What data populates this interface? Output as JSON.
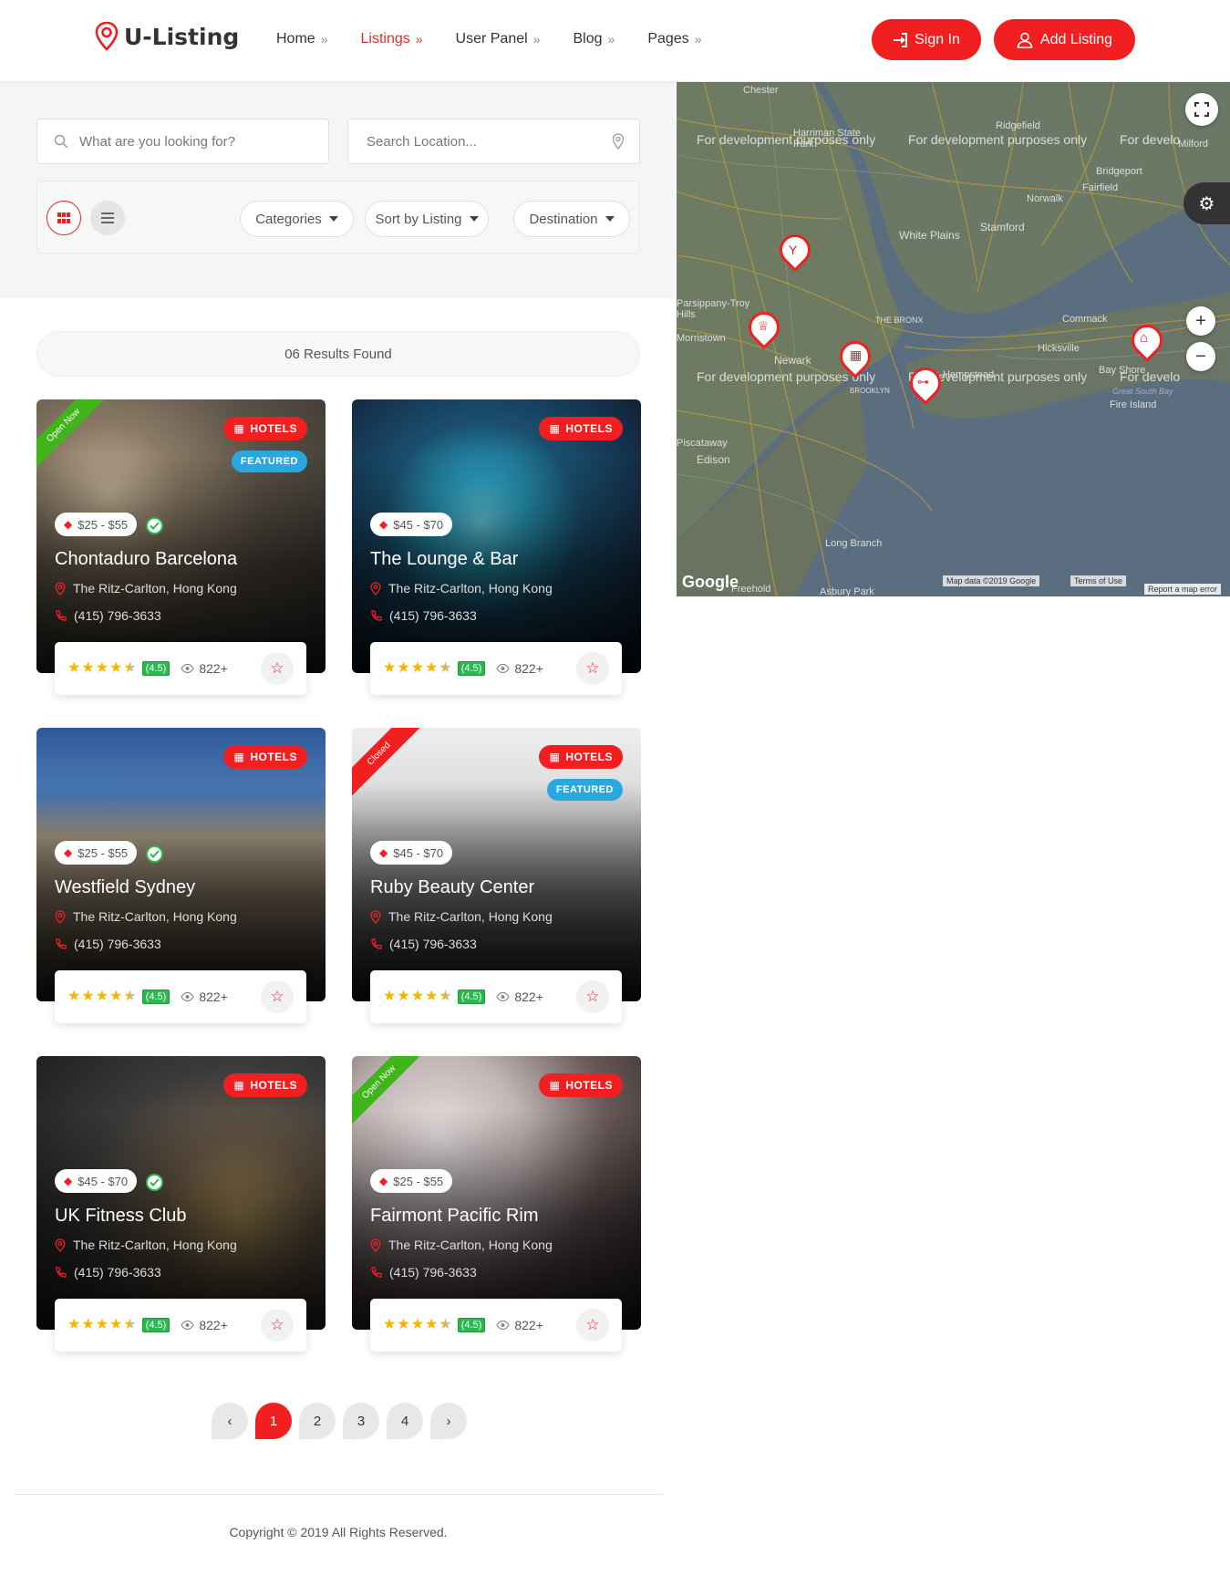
{
  "header": {
    "logo_text": "U-Listing",
    "nav": [
      {
        "label": "Home",
        "active": false
      },
      {
        "label": "Listings",
        "active": true
      },
      {
        "label": "User Panel",
        "active": false
      },
      {
        "label": "Blog",
        "active": false
      },
      {
        "label": "Pages",
        "active": false
      }
    ],
    "sign_in_label": "Sign In",
    "add_listing_label": "Add Listing"
  },
  "search": {
    "query_placeholder": "What are you looking for?",
    "location_placeholder": "Search Location..."
  },
  "filters": {
    "categories_label": "Categories",
    "sort_label": "Sort by Listing",
    "destination_label": "Destination"
  },
  "results_text": "06 Results Found",
  "colors": {
    "accent": "#f21f21",
    "featured": "#29a8e0",
    "open": "#3fb51b",
    "rating": "#2db84d",
    "star": "#f4b400"
  },
  "listings": [
    {
      "title": "Chontaduro Barcelona",
      "category": "HOTELS",
      "featured": "FEATURED",
      "ribbon": "Open Now",
      "price": "$25 - $55",
      "verified": true,
      "address": "The Ritz-Carlton, Hong Kong",
      "phone": "(415) 796-3633",
      "rating": "(4.5)",
      "views": "822+"
    },
    {
      "title": "The Lounge & Bar",
      "category": "HOTELS",
      "featured": "",
      "ribbon": "",
      "price": "$45 - $70",
      "verified": false,
      "address": "The Ritz-Carlton, Hong Kong",
      "phone": "(415) 796-3633",
      "rating": "(4.5)",
      "views": "822+"
    },
    {
      "title": "Westfield Sydney",
      "category": "HOTELS",
      "featured": "",
      "ribbon": "",
      "price": "$25 - $55",
      "verified": true,
      "address": "The Ritz-Carlton, Hong Kong",
      "phone": "(415) 796-3633",
      "rating": "(4.5)",
      "views": "822+"
    },
    {
      "title": "Ruby Beauty Center",
      "category": "HOTELS",
      "featured": "FEATURED",
      "ribbon": "Closed",
      "price": "$45 - $70",
      "verified": false,
      "address": "The Ritz-Carlton, Hong Kong",
      "phone": "(415) 796-3633",
      "rating": "(4.5)",
      "views": "822+"
    },
    {
      "title": "UK Fitness Club",
      "category": "HOTELS",
      "featured": "",
      "ribbon": "",
      "price": "$45 - $70",
      "verified": true,
      "address": "The Ritz-Carlton, Hong Kong",
      "phone": "(415) 796-3633",
      "rating": "(4.5)",
      "views": "822+"
    },
    {
      "title": "Fairmont Pacific Rim",
      "category": "HOTELS",
      "featured": "",
      "ribbon": "Open Now",
      "price": "$25 - $55",
      "verified": false,
      "address": "The Ritz-Carlton, Hong Kong",
      "phone": "(415) 796-3633",
      "rating": "(4.5)",
      "views": "822+"
    }
  ],
  "pagination": {
    "prev": "‹",
    "pages": [
      "1",
      "2",
      "3",
      "4"
    ],
    "current": "1",
    "next": "›"
  },
  "map": {
    "watermark": "For development purposes only",
    "watermark_cut": "For develo",
    "places": [
      "Chester",
      "Harriman State Park",
      "Ridgefield",
      "Bridgeport",
      "Fairfield",
      "Norwalk",
      "Stamford",
      "White Plains",
      "Parsippany-Troy Hills",
      "Morristown",
      "THE BRONX",
      "Commack",
      "Hicksville",
      "Newark",
      "BROOKLYN",
      "Hempstead",
      "Bay Shore",
      "Fire Island",
      "Great South Bay",
      "Piscataway",
      "Edison",
      "Long Branch",
      "Freehold",
      "Asbury Park",
      "Milford"
    ],
    "google": "Google",
    "map_data": "Map data ©2019 Google",
    "terms": "Terms of Use",
    "report": "Report a map error",
    "zoom_in": "+",
    "zoom_out": "−"
  },
  "footer": {
    "copyright": "Copyright © 2019 All Rights Reserved."
  }
}
